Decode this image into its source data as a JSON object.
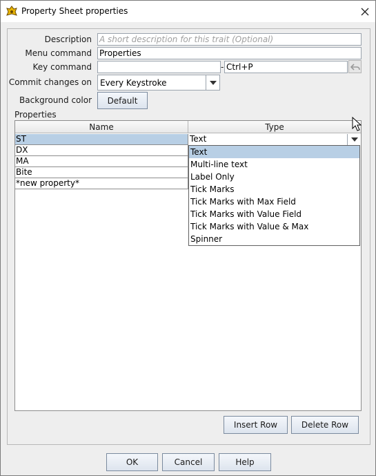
{
  "window": {
    "title": "Property Sheet properties"
  },
  "form": {
    "description_label": "Description",
    "description_placeholder": "A short description for this trait (Optional)",
    "menu_command_label": "Menu command",
    "menu_command_value": "Properties",
    "key_command_label": "Key command",
    "key_command_value": "",
    "key_command_dash": "-",
    "key_command_display": "Ctrl+P",
    "commit_label": "Commit changes on",
    "commit_value": "Every Keystroke",
    "bg_color_label": "Background color",
    "bg_color_button": "Default",
    "properties_label": "Properties"
  },
  "table": {
    "headers": [
      "Name",
      "Type"
    ],
    "rows": [
      {
        "name": "ST",
        "type": "Text"
      },
      {
        "name": "DX"
      },
      {
        "name": "MA"
      },
      {
        "name": "Bite"
      },
      {
        "name": "*new property*"
      }
    ],
    "type_options": [
      "Text",
      "Multi-line text",
      "Label Only",
      "Tick Marks",
      "Tick Marks with Max Field",
      "Tick Marks with Value Field",
      "Tick Marks with Value & Max",
      "Spinner"
    ],
    "selected_option": "Text"
  },
  "actions": {
    "insert_row": "Insert Row",
    "delete_row": "Delete Row"
  },
  "footer": {
    "ok": "OK",
    "cancel": "Cancel",
    "help": "Help"
  },
  "colors": {
    "selection": "#b8cfe5",
    "background": "#eeeeee",
    "button_border": "#7a8a9e"
  },
  "icons": {
    "app": "vassal-app-icon",
    "close": "close-icon",
    "undo": "undo-arrow-icon",
    "dropdown": "chevron-down-icon",
    "cursor": "mouse-cursor-icon"
  }
}
